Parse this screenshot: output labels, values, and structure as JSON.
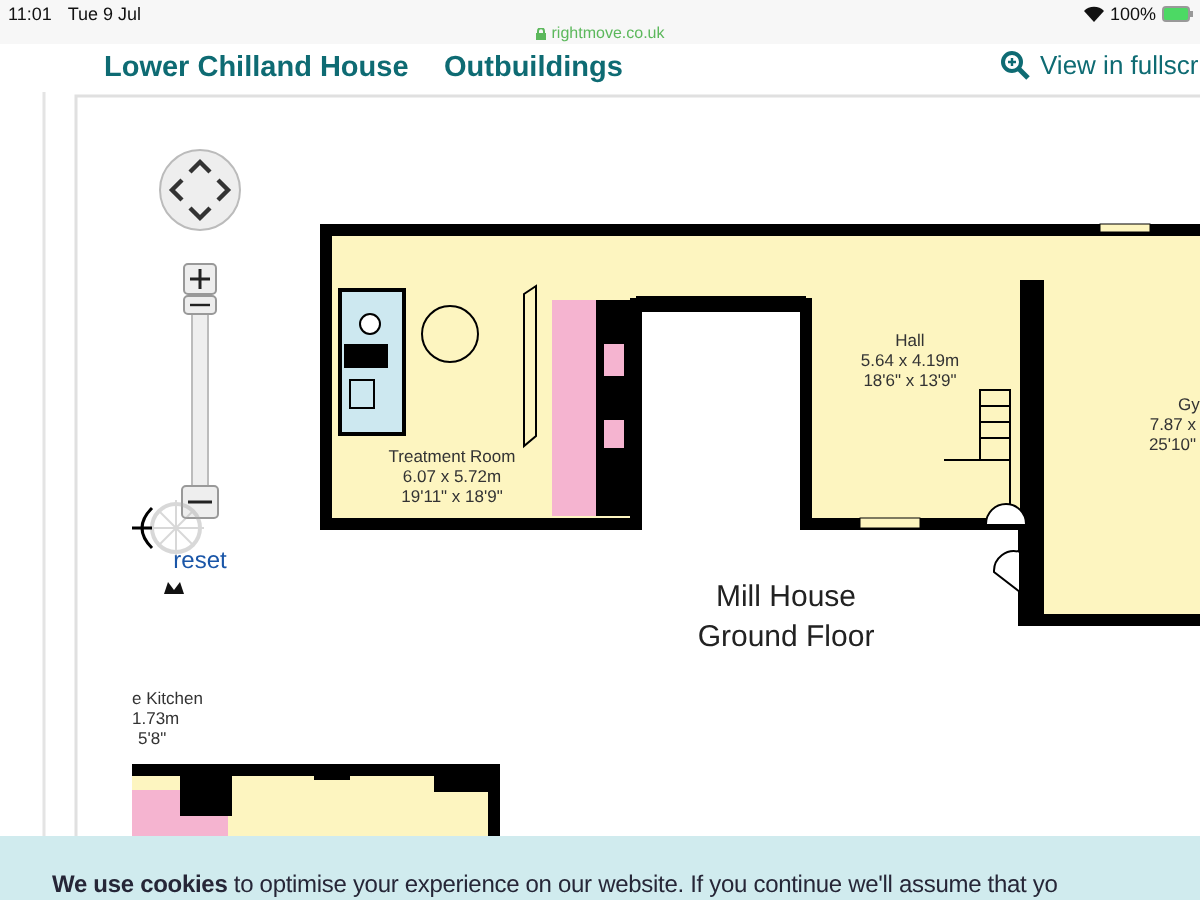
{
  "status_bar": {
    "time": "11:01",
    "date": "Tue 9 Jul",
    "url": "rightmove.co.uk",
    "battery": "100%"
  },
  "tabs": [
    {
      "label": "Lower Chilland House"
    },
    {
      "label": "Outbuildings"
    }
  ],
  "fullscreen_link": "View in fullscr",
  "map_controls": {
    "reset": "reset"
  },
  "floor_plan": {
    "rooms": [
      {
        "name": "Treatment Room",
        "metric": "6.07 x 5.72m",
        "imperial": "19'11\" x 18'9\""
      },
      {
        "name": "Hall",
        "metric": "5.64 x 4.19m",
        "imperial": "18'6\" x 13'9\""
      },
      {
        "name": "Gy",
        "metric": "7.87 x",
        "imperial": "25'10\""
      },
      {
        "name": "e Kitchen",
        "metric": "1.73m",
        "imperial": "5'8\""
      }
    ],
    "caption": [
      "Mill House",
      "Ground Floor"
    ]
  },
  "cookie_banner": {
    "text": "**We use cookies** to optimise your experience on our website. If you continue we'll assume that yo"
  }
}
